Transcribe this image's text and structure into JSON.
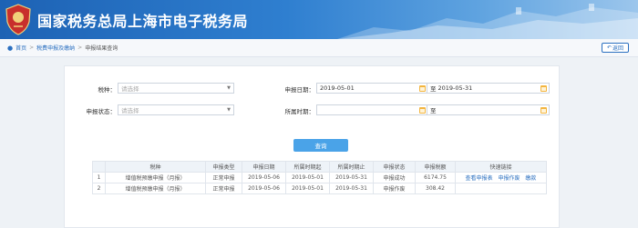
{
  "banner": {
    "title": "国家税务总局上海市电子税务局"
  },
  "breadcrumb": {
    "items": [
      "首页",
      "税费申报及缴纳",
      "申报结果查询"
    ],
    "back_label": "返回"
  },
  "form": {
    "tax_type": {
      "label": "税种：",
      "placeholder": "请选择"
    },
    "filing_status": {
      "label": "申报状态：",
      "placeholder": "请选择"
    },
    "filing_date": {
      "label": "申报日期：",
      "from": "2019-05-01",
      "to_label": "至",
      "to": "2019-05-31"
    },
    "period": {
      "label": "所属时期：",
      "from": "",
      "to_label": "至",
      "to": ""
    },
    "query_button": "查询"
  },
  "table": {
    "headers": [
      "",
      "税种",
      "申报类型",
      "申报日期",
      "所属时期起",
      "所属时期止",
      "申报状态",
      "申报税额",
      "快速链接"
    ],
    "rows": [
      {
        "no": "1",
        "tax": "增值税预缴申报（月报）",
        "type": "正常申报",
        "date": "2019-05-06",
        "start": "2019-05-01",
        "end": "2019-05-31",
        "status": "申报成功",
        "amount": "6174.75",
        "links": [
          "查看申报表",
          "申报作废",
          "缴款"
        ]
      },
      {
        "no": "2",
        "tax": "增值税预缴申报（月报）",
        "type": "正常申报",
        "date": "2019-05-06",
        "start": "2019-05-01",
        "end": "2019-05-31",
        "status": "申报作废",
        "amount": "308.42",
        "links": []
      }
    ]
  },
  "colors": {
    "banner": "#1d62b4",
    "accent": "#4aa3e8",
    "link": "#2a6fc0",
    "calendar": "#f3b53f"
  }
}
